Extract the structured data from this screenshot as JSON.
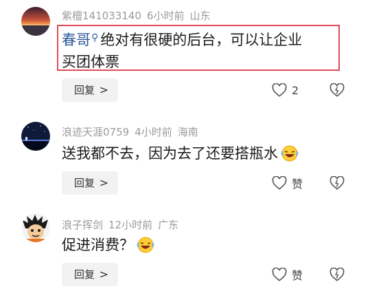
{
  "comments": [
    {
      "username": "紫檀141033140",
      "time": "6小时前",
      "location": "山东",
      "mention": "春哥",
      "text_line1": "绝对有很硬的后台，可以让企业",
      "text_line2": "买团体票",
      "reply_label": "回复",
      "reply_chevron": ">",
      "like_count": "2",
      "avatar_icon": "sunset-avatar-icon"
    },
    {
      "username": "浪迹天涯0759",
      "time": "4小时前",
      "location": "海南",
      "text": "送我都不去，因为去了还要搭瓶水",
      "reply_label": "回复",
      "reply_chevron": ">",
      "like_label": "赞",
      "avatar_icon": "night-sky-avatar-icon"
    },
    {
      "username": "浪子挥剑",
      "time": "12小时前",
      "location": "广东",
      "text": "促进消费？",
      "reply_label": "回复",
      "reply_chevron": ">",
      "like_label": "赞",
      "avatar_icon": "cartoon-avatar-icon"
    }
  ],
  "colors": {
    "highlight_border": "#e24a56",
    "mention_blue": "#2f5b9f",
    "meta_gray": "#9a9a9a",
    "button_bg": "#f2f2f2"
  }
}
